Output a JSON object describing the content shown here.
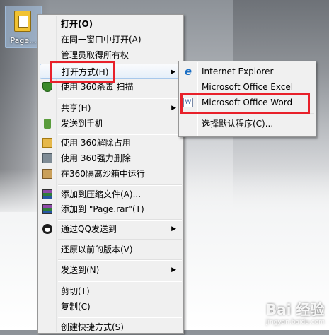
{
  "desktop": {
    "icon_label": "Page..."
  },
  "context_menu": {
    "open": "打开(O)",
    "open_same_window": "在同一窗口中打开(A)",
    "admin_ownership": "管理员取得所有权",
    "open_with": "打开方式(H)",
    "scan_360": "使用 360杀毒 扫描",
    "share": "共享(H)",
    "send_to_phone": "发送到手机",
    "unlock_360": "使用 360解除占用",
    "force_delete_360": "使用 360强力删除",
    "sandbox_360": "在360隔离沙箱中运行",
    "add_archive": "添加到压缩文件(A)...",
    "add_page_rar": "添加到 \"Page.rar\"(T)",
    "send_qq": "通过QQ发送到",
    "restore_versions": "还原以前的版本(V)",
    "send_to": "发送到(N)",
    "cut": "剪切(T)",
    "copy": "复制(C)",
    "create_shortcut": "创建快捷方式(S)"
  },
  "submenu": {
    "ie": "Internet Explorer",
    "excel": "Microsoft Office Excel",
    "word": "Microsoft Office Word",
    "choose_default": "选择默认程序(C)..."
  },
  "icons": {
    "ie": "e",
    "word": "W"
  },
  "watermark": {
    "brand": "Bai 经验",
    "url": "jingyan.baidu.com"
  },
  "colors": {
    "highlight_box": "#e8202a"
  }
}
